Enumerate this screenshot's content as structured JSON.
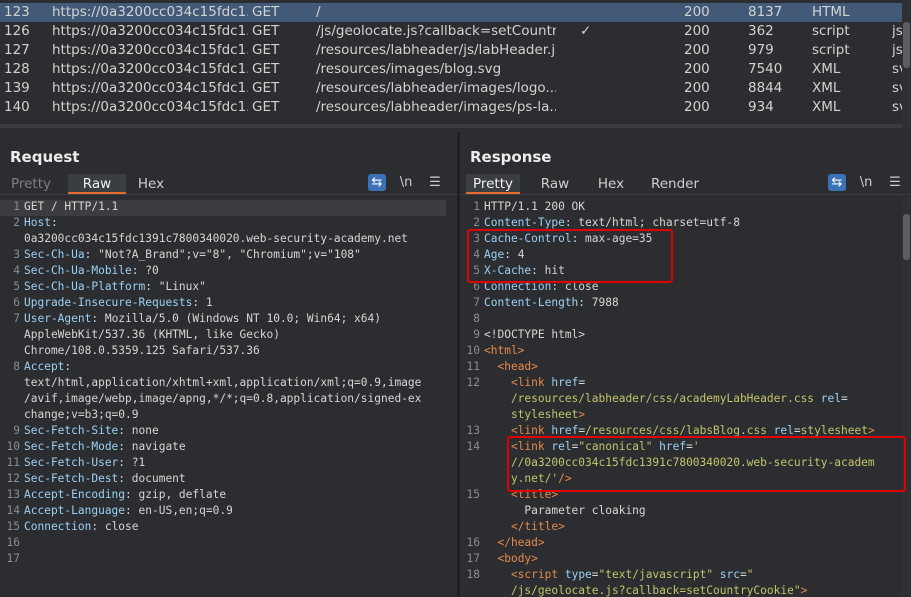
{
  "history": {
    "rows": [
      {
        "id": "123",
        "host": "https://0a3200cc034c15fdc1...",
        "method": "GET",
        "url": "/",
        "check": "",
        "status": "200",
        "length": "8137",
        "mime": "HTML",
        "ext": "",
        "selected": true
      },
      {
        "id": "126",
        "host": "https://0a3200cc034c15fdc1...",
        "method": "GET",
        "url": "/js/geolocate.js?callback=setCountr...",
        "check": "✓",
        "status": "200",
        "length": "362",
        "mime": "script",
        "ext": "js",
        "selected": false
      },
      {
        "id": "127",
        "host": "https://0a3200cc034c15fdc1...",
        "method": "GET",
        "url": "/resources/labheader/js/labHeader.js",
        "check": "",
        "status": "200",
        "length": "979",
        "mime": "script",
        "ext": "js",
        "selected": false
      },
      {
        "id": "128",
        "host": "https://0a3200cc034c15fdc1...",
        "method": "GET",
        "url": "/resources/images/blog.svg",
        "check": "",
        "status": "200",
        "length": "7540",
        "mime": "XML",
        "ext": "svg",
        "selected": false
      },
      {
        "id": "139",
        "host": "https://0a3200cc034c15fdc1...",
        "method": "GET",
        "url": "/resources/labheader/images/logo...",
        "check": "",
        "status": "200",
        "length": "8844",
        "mime": "XML",
        "ext": "svg",
        "selected": false
      },
      {
        "id": "140",
        "host": "https://0a3200cc034c15fdc1...",
        "method": "GET",
        "url": "/resources/labheader/images/ps-la...",
        "check": "",
        "status": "200",
        "length": "934",
        "mime": "XML",
        "ext": "svg",
        "selected": false
      }
    ]
  },
  "request": {
    "title": "Request",
    "tabs": [
      "Pretty",
      "Raw",
      "Hex"
    ],
    "active_tab": "Raw",
    "newline_toggle": "\\n",
    "lines": [
      {
        "n": "1",
        "segs": [
          [
            "v",
            "GET / HTTP/1.1"
          ]
        ]
      },
      {
        "n": "2",
        "segs": [
          [
            "k",
            "Host"
          ],
          [
            "v",
            ":"
          ]
        ]
      },
      {
        "n": "",
        "segs": [
          [
            "v",
            "0a3200cc034c15fdc1391c7800340020.web-security-academy.net"
          ]
        ]
      },
      {
        "n": "3",
        "segs": [
          [
            "k",
            "Sec-Ch-Ua"
          ],
          [
            "v",
            ": \"Not?A_Brand\";v=\"8\", \"Chromium\";v=\"108\""
          ]
        ]
      },
      {
        "n": "4",
        "segs": [
          [
            "k",
            "Sec-Ch-Ua-Mobile"
          ],
          [
            "v",
            ": ?0"
          ]
        ]
      },
      {
        "n": "5",
        "segs": [
          [
            "k",
            "Sec-Ch-Ua-Platform"
          ],
          [
            "v",
            ": \"Linux\""
          ]
        ]
      },
      {
        "n": "6",
        "segs": [
          [
            "k",
            "Upgrade-Insecure-Requests"
          ],
          [
            "v",
            ": 1"
          ]
        ]
      },
      {
        "n": "7",
        "segs": [
          [
            "k",
            "User-Agent"
          ],
          [
            "v",
            ": Mozilla/5.0 (Windows NT 10.0; Win64; x64)"
          ]
        ]
      },
      {
        "n": "",
        "segs": [
          [
            "v",
            "AppleWebKit/537.36 (KHTML, like Gecko)"
          ]
        ]
      },
      {
        "n": "",
        "segs": [
          [
            "v",
            "Chrome/108.0.5359.125 Safari/537.36"
          ]
        ]
      },
      {
        "n": "8",
        "segs": [
          [
            "k",
            "Accept"
          ],
          [
            "v",
            ":"
          ]
        ]
      },
      {
        "n": "",
        "segs": [
          [
            "v",
            "text/html,application/xhtml+xml,application/xml;q=0.9,image"
          ]
        ]
      },
      {
        "n": "",
        "segs": [
          [
            "v",
            "/avif,image/webp,image/apng,*/*;q=0.8,application/signed-ex"
          ]
        ]
      },
      {
        "n": "",
        "segs": [
          [
            "v",
            "change;v=b3;q=0.9"
          ]
        ]
      },
      {
        "n": "9",
        "segs": [
          [
            "k",
            "Sec-Fetch-Site"
          ],
          [
            "v",
            ": none"
          ]
        ]
      },
      {
        "n": "10",
        "segs": [
          [
            "k",
            "Sec-Fetch-Mode"
          ],
          [
            "v",
            ": navigate"
          ]
        ]
      },
      {
        "n": "11",
        "segs": [
          [
            "k",
            "Sec-Fetch-User"
          ],
          [
            "v",
            ": ?1"
          ]
        ]
      },
      {
        "n": "12",
        "segs": [
          [
            "k",
            "Sec-Fetch-Dest"
          ],
          [
            "v",
            ": document"
          ]
        ]
      },
      {
        "n": "13",
        "segs": [
          [
            "k",
            "Accept-Encoding"
          ],
          [
            "v",
            ": gzip, deflate"
          ]
        ]
      },
      {
        "n": "14",
        "segs": [
          [
            "k",
            "Accept-Language"
          ],
          [
            "v",
            ": en-US,en;q=0.9"
          ]
        ]
      },
      {
        "n": "15",
        "segs": [
          [
            "k",
            "Connection"
          ],
          [
            "v",
            ": close"
          ]
        ]
      },
      {
        "n": "16",
        "segs": []
      },
      {
        "n": "17",
        "segs": []
      }
    ]
  },
  "response": {
    "title": "Response",
    "tabs": [
      "Pretty",
      "Raw",
      "Hex",
      "Render"
    ],
    "active_tab": "Pretty",
    "newline_toggle": "\\n",
    "lines": [
      {
        "n": "1",
        "segs": [
          [
            "v",
            "HTTP/1.1 200 OK"
          ]
        ]
      },
      {
        "n": "2",
        "segs": [
          [
            "k",
            "Content-Type"
          ],
          [
            "v",
            ": text/html; charset=utf-8"
          ]
        ]
      },
      {
        "n": "3",
        "segs": [
          [
            "k",
            "Cache-Control"
          ],
          [
            "v",
            ": max-age=35"
          ]
        ]
      },
      {
        "n": "4",
        "segs": [
          [
            "k",
            "Age"
          ],
          [
            "v",
            ": 4"
          ]
        ]
      },
      {
        "n": "5",
        "segs": [
          [
            "k",
            "X-Cache"
          ],
          [
            "v",
            ": hit"
          ]
        ]
      },
      {
        "n": "6",
        "segs": [
          [
            "k",
            "Connection"
          ],
          [
            "v",
            ": close"
          ]
        ]
      },
      {
        "n": "7",
        "segs": [
          [
            "k",
            "Content-Length"
          ],
          [
            "v",
            ": 7988"
          ]
        ]
      },
      {
        "n": "8",
        "segs": []
      },
      {
        "n": "9",
        "segs": [
          [
            "v",
            "<!DOCTYPE html>"
          ]
        ]
      },
      {
        "n": "10",
        "segs": [
          [
            "tag",
            "<html>"
          ]
        ]
      },
      {
        "n": "11",
        "segs": [
          [
            "v",
            "  "
          ],
          [
            "tag",
            "<head>"
          ]
        ]
      },
      {
        "n": "12",
        "segs": [
          [
            "v",
            "    "
          ],
          [
            "tag",
            "<link "
          ],
          [
            "attr",
            "href"
          ],
          [
            "v",
            "="
          ]
        ]
      },
      {
        "n": "",
        "segs": [
          [
            "str",
            "    /resources/labheader/css/academyLabHeader.css "
          ],
          [
            "attr",
            "rel"
          ],
          [
            "v",
            "="
          ]
        ]
      },
      {
        "n": "",
        "segs": [
          [
            "str",
            "    stylesheet"
          ],
          [
            "tag",
            ">"
          ]
        ]
      },
      {
        "n": "13",
        "segs": [
          [
            "v",
            "    "
          ],
          [
            "tag",
            "<link "
          ],
          [
            "attr",
            "href"
          ],
          [
            "v",
            "="
          ],
          [
            "str",
            "/resources/css/labsBlog.css "
          ],
          [
            "attr",
            "rel"
          ],
          [
            "v",
            "="
          ],
          [
            "str",
            "stylesheet"
          ],
          [
            "tag",
            ">"
          ]
        ]
      },
      {
        "n": "14",
        "segs": [
          [
            "v",
            "    "
          ],
          [
            "tag",
            "<link "
          ],
          [
            "attr",
            "rel"
          ],
          [
            "v",
            "="
          ],
          [
            "str",
            "\"canonical\" "
          ],
          [
            "attr",
            "href"
          ],
          [
            "v",
            "="
          ],
          [
            "str",
            "'"
          ]
        ]
      },
      {
        "n": "",
        "segs": [
          [
            "str",
            "    //0a3200cc034c15fdc1391c7800340020.web-security-academ"
          ]
        ]
      },
      {
        "n": "",
        "segs": [
          [
            "str",
            "    y.net/'"
          ],
          [
            "tag",
            "/>"
          ]
        ]
      },
      {
        "n": "15",
        "segs": [
          [
            "v",
            "    "
          ],
          [
            "tag",
            "<title>"
          ]
        ]
      },
      {
        "n": "",
        "segs": [
          [
            "v",
            "      Parameter cloaking"
          ]
        ]
      },
      {
        "n": "",
        "segs": [
          [
            "v",
            "    "
          ],
          [
            "tag",
            "</title>"
          ]
        ]
      },
      {
        "n": "16",
        "segs": [
          [
            "v",
            "  "
          ],
          [
            "tag",
            "</head>"
          ]
        ]
      },
      {
        "n": "17",
        "segs": [
          [
            "v",
            "  "
          ],
          [
            "tag",
            "<body>"
          ]
        ]
      },
      {
        "n": "18",
        "segs": [
          [
            "v",
            "    "
          ],
          [
            "tag",
            "<script "
          ],
          [
            "attr",
            "type"
          ],
          [
            "v",
            "="
          ],
          [
            "str",
            "\"text/javascript\" "
          ],
          [
            "attr",
            "src"
          ],
          [
            "v",
            "="
          ],
          [
            "str",
            "\""
          ]
        ]
      },
      {
        "n": "",
        "segs": [
          [
            "str",
            "    /js/geolocate.js?callback=setCountryCookie\""
          ],
          [
            "tag",
            ">"
          ]
        ]
      }
    ]
  },
  "colors": {
    "accent_tab": "#e46a2e",
    "selected_row": "#425a78",
    "highlight_box": "#e00000",
    "header_key": "#9cd0f3",
    "html_tag": "#e6894d",
    "html_string": "#c4c46a"
  },
  "icons": [
    "wrap-lines-icon",
    "newline-toggle-icon",
    "menu-icon",
    "split-horizontal-view-icon",
    "split-vertical-view-icon",
    "single-pane-view-icon"
  ]
}
